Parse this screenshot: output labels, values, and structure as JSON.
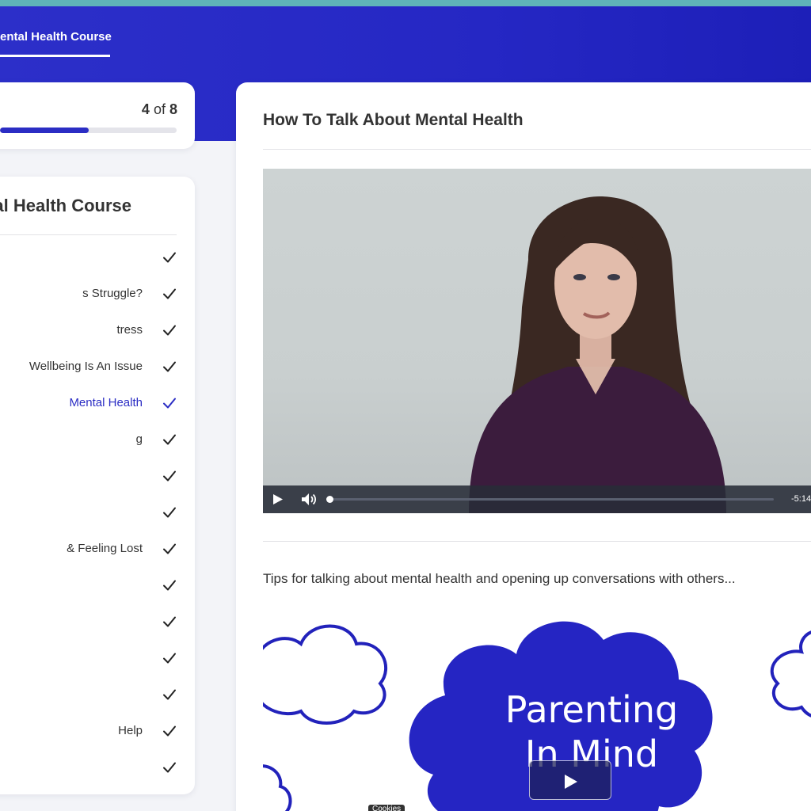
{
  "header": {
    "tab_label": "ental Health Course"
  },
  "progress": {
    "current": "4",
    "of_word": "of",
    "total": "8",
    "fraction": 0.5
  },
  "course": {
    "title": "al Health Course",
    "lessons": [
      {
        "label": "",
        "completed": true,
        "active": false
      },
      {
        "label": "s Struggle?",
        "completed": true,
        "active": false
      },
      {
        "label": "tress",
        "completed": true,
        "active": false
      },
      {
        "label": "Wellbeing Is An Issue",
        "completed": true,
        "active": false
      },
      {
        "label": "Mental Health",
        "completed": true,
        "active": true
      },
      {
        "label": "g",
        "completed": true,
        "active": false
      },
      {
        "label": "",
        "completed": true,
        "active": false
      },
      {
        "label": "",
        "completed": true,
        "active": false
      },
      {
        "label": "& Feeling Lost",
        "completed": true,
        "active": false
      },
      {
        "label": "",
        "completed": true,
        "active": false
      },
      {
        "label": "",
        "completed": true,
        "active": false
      },
      {
        "label": "",
        "completed": true,
        "active": false
      },
      {
        "label": "",
        "completed": true,
        "active": false
      },
      {
        "label": "Help",
        "completed": true,
        "active": false
      },
      {
        "label": "",
        "completed": true,
        "active": false
      }
    ]
  },
  "main": {
    "lesson_title": "How To Talk About Mental Health",
    "video": {
      "time_remaining": "-5:14",
      "progress": 0.0
    },
    "description": "Tips for talking about mental health and opening up conversations with others...",
    "promo": {
      "line1": "Parenting",
      "line2": "In Mind"
    }
  },
  "cookies_label": "Cookies",
  "colors": {
    "brand": "#2b2dc4",
    "header": "#2527c4",
    "accent_teal": "#5fb3b8"
  },
  "icons": {
    "lesson_complete": "checkmark-icon",
    "play": "play-icon",
    "volume": "volume-icon"
  }
}
